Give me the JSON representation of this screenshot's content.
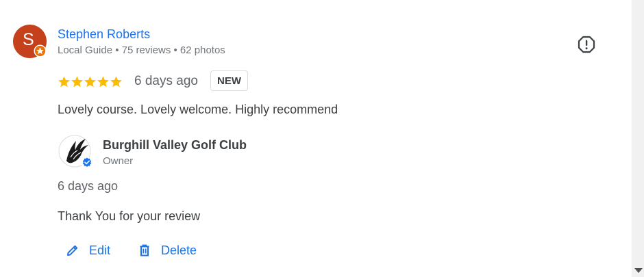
{
  "reviewer": {
    "initial": "S",
    "name": "Stephen Roberts",
    "meta": "Local Guide • 75 reviews • 62 photos",
    "avatar_color": "#c5411b"
  },
  "review": {
    "rating": 5,
    "max_rating": 5,
    "time_ago": "6 days ago",
    "badge": "NEW",
    "text": "Lovely course. Lovely welcome. Highly recommend"
  },
  "owner_response": {
    "name": "Burghill Valley Golf Club",
    "role": "Owner",
    "time_ago": "6 days ago",
    "text": "Thank You for your review"
  },
  "actions": {
    "edit_label": "Edit",
    "delete_label": "Delete"
  },
  "colors": {
    "link_blue": "#1a73e8",
    "star_gold": "#fbbc04",
    "verified_blue": "#1a73e8"
  },
  "icons": {
    "flag": "report-flag-icon",
    "edit": "pencil-icon",
    "delete": "trash-icon"
  }
}
